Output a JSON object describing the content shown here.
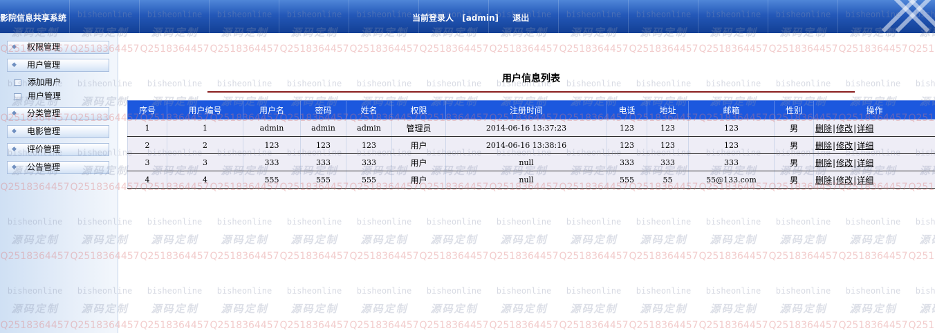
{
  "header": {
    "app_title": "影院信息共享系统",
    "login_label": "当前登录人",
    "login_user": "[admin]",
    "logout_label": "退出"
  },
  "sidebar": {
    "items": [
      {
        "label": "权限管理"
      },
      {
        "label": "用户管理"
      },
      {
        "label": "添加用户"
      },
      {
        "label": "用户管理"
      },
      {
        "label": "分类管理"
      },
      {
        "label": "电影管理"
      },
      {
        "label": "评价管理"
      },
      {
        "label": "公告管理"
      }
    ]
  },
  "main": {
    "title": "用户信息列表",
    "columns": [
      "序号",
      "用户编号",
      "用户名",
      "密码",
      "姓名",
      "权限",
      "注册时间",
      "电话",
      "地址",
      "邮箱",
      "性别",
      "操作"
    ],
    "rows": [
      {
        "seq": "1",
        "uid": "1",
        "username": "admin",
        "password": "admin",
        "name": "admin",
        "role": "管理员",
        "reg_time": "2014-06-16 13:37:23",
        "phone": "123",
        "address": "123",
        "email": "123",
        "gender": "男"
      },
      {
        "seq": "2",
        "uid": "2",
        "username": "123",
        "password": "123",
        "name": "123",
        "role": "用户",
        "reg_time": "2014-06-16 13:38:16",
        "phone": "123",
        "address": "123",
        "email": "123",
        "gender": "男"
      },
      {
        "seq": "3",
        "uid": "3",
        "username": "333",
        "password": "333",
        "name": "333",
        "role": "用户",
        "reg_time": "null",
        "phone": "333",
        "address": "333",
        "email": "333",
        "gender": "男"
      },
      {
        "seq": "4",
        "uid": "4",
        "username": "555",
        "password": "555",
        "name": "555",
        "role": "用户",
        "reg_time": "null",
        "phone": "555",
        "address": "55",
        "email": "55@133.com",
        "gender": "男"
      }
    ],
    "actions": {
      "delete": "删除",
      "edit": "修改",
      "detail": "详细",
      "separator": "|"
    }
  },
  "watermark": {
    "line1": "bisheonline",
    "line2": "源码定制",
    "line3": "Q2518364457"
  },
  "colors": {
    "header_blue": "#2458b8",
    "table_header": "#1c58de",
    "title_underline": "#8a1e1e"
  }
}
